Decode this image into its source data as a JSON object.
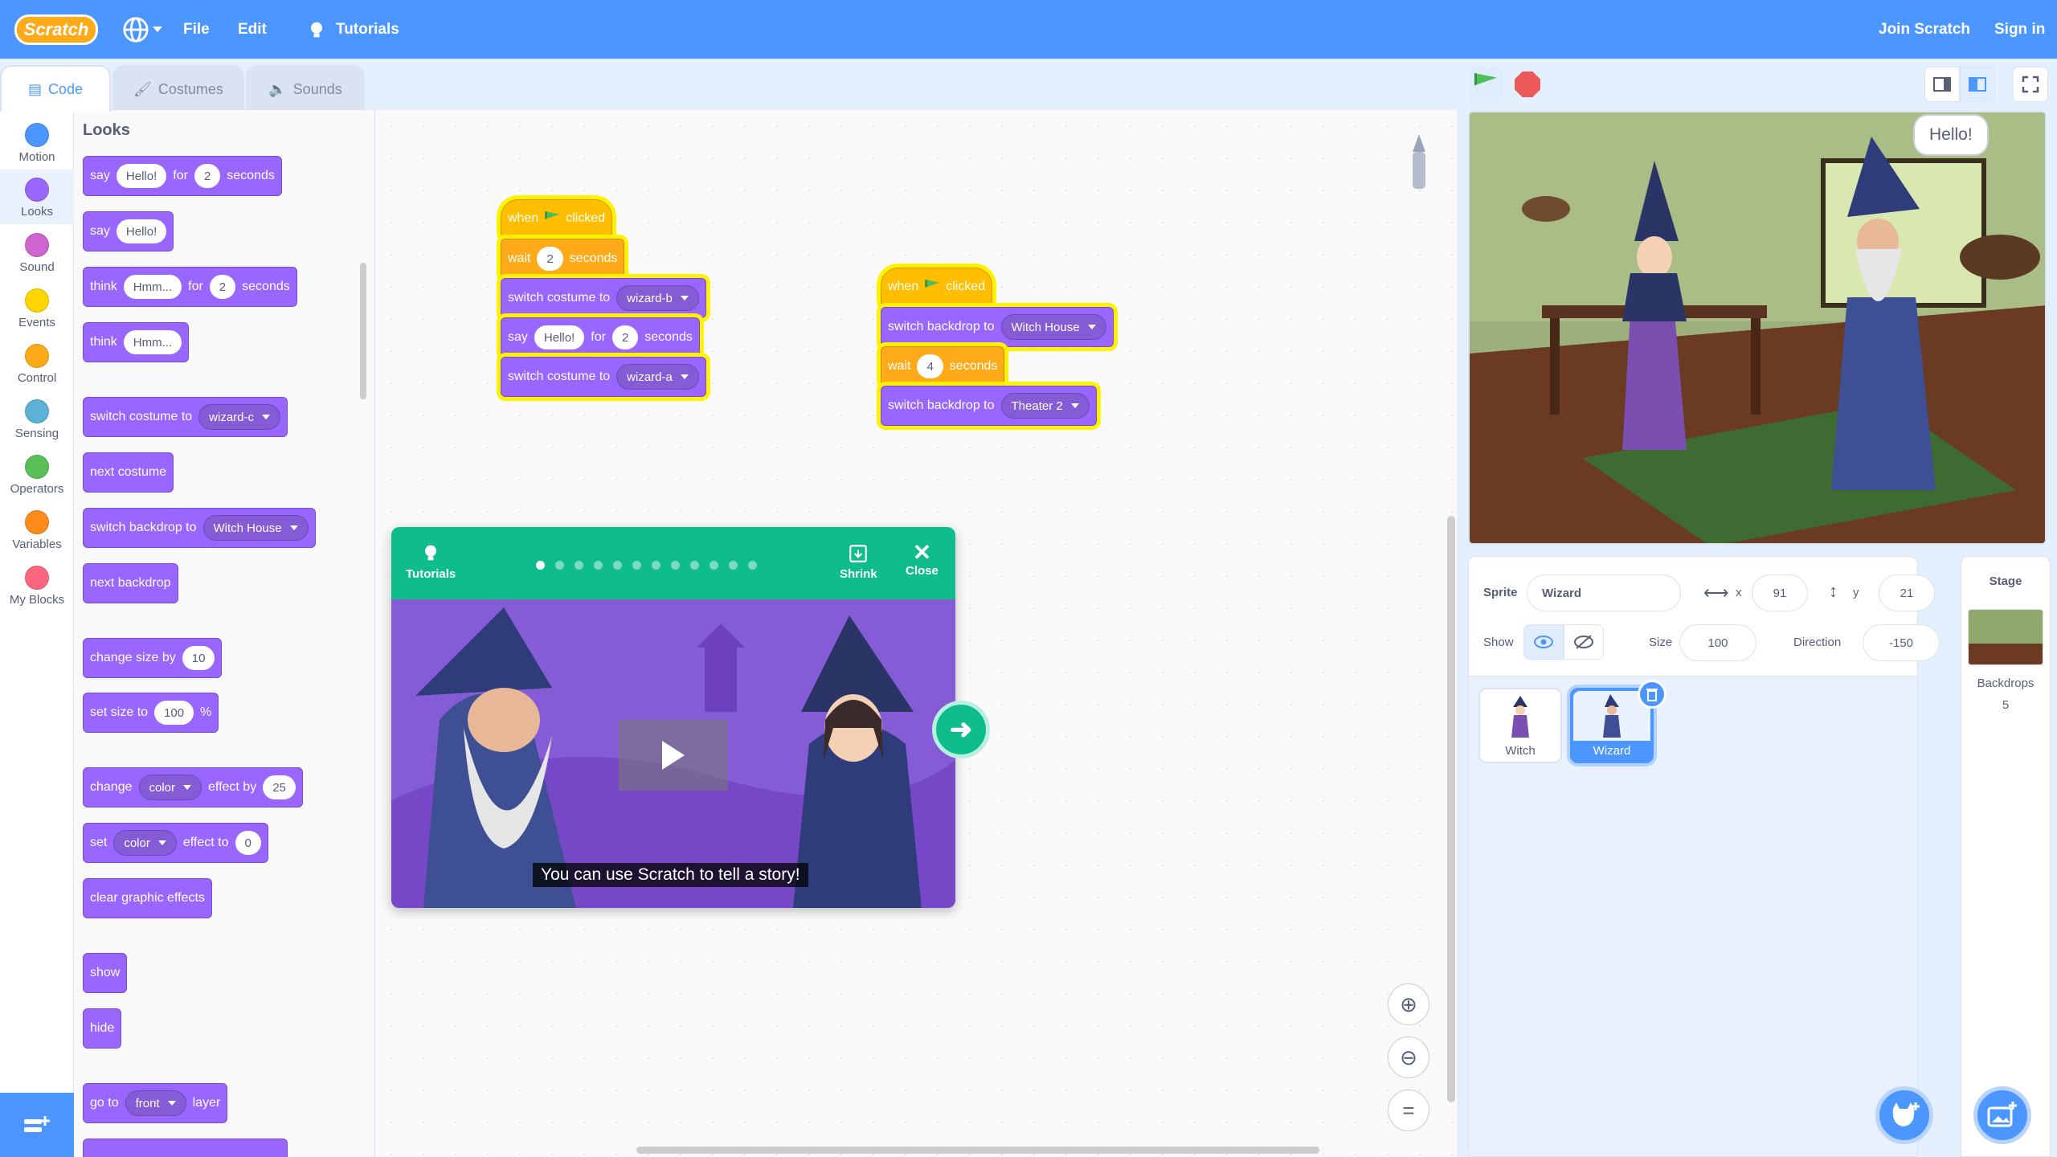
{
  "menu": {
    "logo": "Scratch",
    "file": "File",
    "edit": "Edit",
    "tutorials": "Tutorials",
    "join": "Join Scratch",
    "signin": "Sign in"
  },
  "tabs": {
    "code": "Code",
    "costumes": "Costumes",
    "sounds": "Sounds"
  },
  "categories": [
    {
      "label": "Motion",
      "color": "#4c97ff"
    },
    {
      "label": "Looks",
      "color": "#9966ff"
    },
    {
      "label": "Sound",
      "color": "#cf63cf"
    },
    {
      "label": "Events",
      "color": "#ffd500"
    },
    {
      "label": "Control",
      "color": "#ffab19"
    },
    {
      "label": "Sensing",
      "color": "#5cb1d6"
    },
    {
      "label": "Operators",
      "color": "#59c059"
    },
    {
      "label": "Variables",
      "color": "#ff8c1a"
    },
    {
      "label": "My Blocks",
      "color": "#ff6680"
    }
  ],
  "palette": {
    "heading": "Looks",
    "say_for": {
      "say": "say",
      "msg": "Hello!",
      "for": "for",
      "secs": "2",
      "seconds": "seconds"
    },
    "say": {
      "say": "say",
      "msg": "Hello!"
    },
    "think_for": {
      "think": "think",
      "msg": "Hmm...",
      "for": "for",
      "secs": "2",
      "seconds": "seconds"
    },
    "think": {
      "think": "think",
      "msg": "Hmm..."
    },
    "switch_costume": {
      "label": "switch costume to",
      "value": "wizard-c"
    },
    "next_costume": "next costume",
    "switch_backdrop": {
      "label": "switch backdrop to",
      "value": "Witch House"
    },
    "next_backdrop": "next backdrop",
    "change_size": {
      "label": "change size by",
      "value": "10"
    },
    "set_size": {
      "label": "set size to",
      "value": "100",
      "unit": "%"
    },
    "change_effect": {
      "label": "change",
      "effect": "color",
      "by": "effect by",
      "value": "25"
    },
    "set_effect": {
      "label": "set",
      "effect": "color",
      "to": "effect to",
      "value": "0"
    },
    "clear_effects": "clear graphic effects",
    "show": "show",
    "hide": "hide",
    "go_to": {
      "label": "go to",
      "value": "front",
      "layer": "layer"
    }
  },
  "script1": {
    "when": "when",
    "clicked": "clicked",
    "wait": "wait",
    "wait_val": "2",
    "seconds": "seconds",
    "costume1_label": "switch costume to",
    "costume1_val": "wizard-b",
    "say": "say",
    "say_msg": "Hello!",
    "for": "for",
    "say_secs": "2",
    "costume2_label": "switch costume to",
    "costume2_val": "wizard-a"
  },
  "script2": {
    "when": "when",
    "clicked": "clicked",
    "backdrop1_label": "switch backdrop to",
    "backdrop1_val": "Witch House",
    "wait": "wait",
    "wait_val": "4",
    "seconds": "seconds",
    "backdrop2_label": "switch backdrop to",
    "backdrop2_val": "Theater 2"
  },
  "tutorial": {
    "title": "Tutorials",
    "shrink": "Shrink",
    "close": "Close",
    "caption": "You can use Scratch to tell a story!",
    "steps": 12,
    "current_step": 1
  },
  "stage": {
    "speech": "Hello!"
  },
  "sprite_info": {
    "sprite_label": "Sprite",
    "name": "Wizard",
    "x_label": "x",
    "x": "91",
    "y_label": "y",
    "y": "21",
    "show_label": "Show",
    "size_label": "Size",
    "size": "100",
    "direction_label": "Direction",
    "direction": "-150"
  },
  "sprites": [
    {
      "name": "Witch",
      "selected": false
    },
    {
      "name": "Wizard",
      "selected": true
    }
  ],
  "stage_panel": {
    "title": "Stage",
    "backdrops_label": "Backdrops",
    "backdrops_count": "5"
  },
  "colors": {
    "accent": "#4c97ff",
    "looks": "#9966ff",
    "events": "#ffbf00",
    "tutorial": "#0fbd8c"
  }
}
